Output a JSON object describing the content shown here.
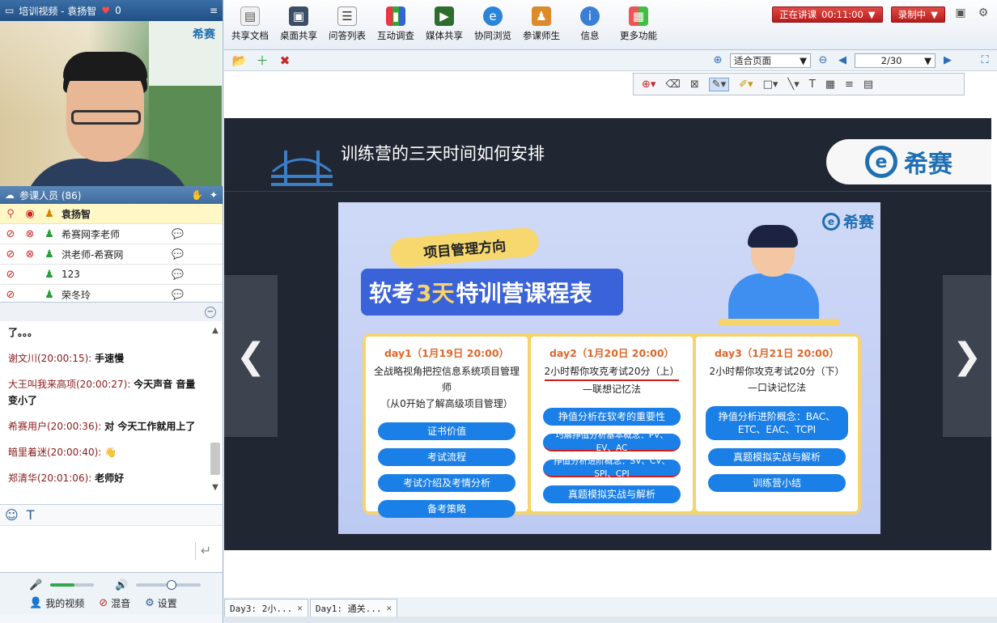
{
  "left_panel": {
    "video_title": "培训视频 - 袁扬智",
    "likes": "0",
    "video_logo": "希赛",
    "participants_title": "参课人员 (86)",
    "participants": [
      {
        "name": "袁扬智",
        "highlight": true
      },
      {
        "name": "希赛网李老师"
      },
      {
        "name": "洪老师-希赛网"
      },
      {
        "name": "123"
      },
      {
        "name": "荣冬玲"
      }
    ],
    "chat_messages": [
      {
        "who": "",
        "text": "了。。。"
      },
      {
        "who": "谢文川(20:00:15):",
        "text": "手速慢"
      },
      {
        "who": "大王叫我来高项(20:00:27):",
        "text": "今天声音 音量变小了"
      },
      {
        "who": "希赛用户(20:00:36):",
        "text": "对 今天工作就用上了"
      },
      {
        "who": "暗里着迷(20:00:40):",
        "text": "👋"
      },
      {
        "who": "郑清华(20:01:06):",
        "text": "老师好"
      }
    ],
    "controls": {
      "my_video": "我的视频",
      "mix": "混音",
      "settings": "设置",
      "mic_level": 0.55,
      "volume_level": 0.55
    }
  },
  "toolbar": {
    "buttons": [
      {
        "label": "共享文档",
        "icon": "doc-icon"
      },
      {
        "label": "桌面共享",
        "icon": "desktop-icon"
      },
      {
        "label": "问答列表",
        "icon": "qa-icon"
      },
      {
        "label": "互动调查",
        "icon": "chart-icon"
      },
      {
        "label": "媒体共享",
        "icon": "media-icon"
      },
      {
        "label": "协同浏览",
        "icon": "browser-icon"
      },
      {
        "label": "参课师生",
        "icon": "users-icon"
      },
      {
        "label": "信息",
        "icon": "info-icon"
      },
      {
        "label": "更多功能",
        "icon": "grid-icon"
      }
    ],
    "lecture_status": "正在讲课",
    "lecture_time": "00:11:00",
    "recording": "录制中"
  },
  "doc_toolbar": {
    "fit": "适合页面",
    "page": "2/30"
  },
  "slide": {
    "title": "训练营的三天时间如何安排",
    "brand": "希赛",
    "poster": {
      "logo": "希赛",
      "tag": "项目管理方向",
      "banner_pre": "软考",
      "banner_hl": "3天",
      "banner_post": "特训营课程表",
      "days": [
        {
          "day": "day1（1月19日 20:00）",
          "desc1": "全战略视角把控信息系统项目管理师",
          "desc2": "（从0开始了解高级项目管理）",
          "items": [
            "证书价值",
            "考试流程",
            "考试介绍及考情分析",
            "备考策略"
          ]
        },
        {
          "day": "day2（1月20日 20:00）",
          "desc1": "2小时帮你攻克考试20分（上）",
          "desc2": "—联想记忆法",
          "items": [
            "挣值分析在软考的重要性",
            "巧解挣值分析基本概念：PV、EV、AC",
            "挣值分析进阶概念：SV、CV、SPI、CPI",
            "真题模拟实战与解析"
          ]
        },
        {
          "day": "day3（1月21日 20:00）",
          "desc1": "2小时帮你攻克考试20分（下）",
          "desc2": "—口诀记忆法",
          "items": [
            "挣值分析进阶概念：BAC、ETC、EAC、TCPI",
            "真题模拟实战与解析",
            "训练营小结"
          ]
        }
      ]
    }
  },
  "tabs": [
    {
      "label": "Day3: 2小..."
    },
    {
      "label": "Day1: 通关..."
    }
  ]
}
